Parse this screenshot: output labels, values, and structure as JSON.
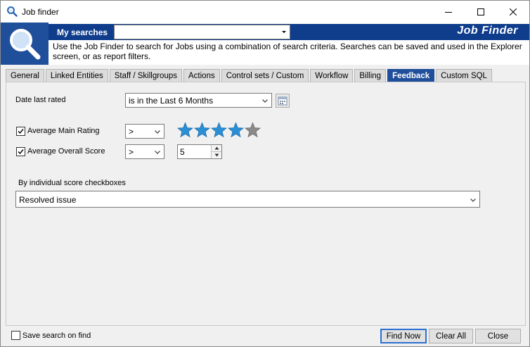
{
  "window": {
    "title": "Job finder",
    "icon": "search-icon"
  },
  "header": {
    "my_searches_label": "My searches",
    "my_searches_value": "",
    "brand": "Job Finder",
    "description": "Use the Job Finder to search for Jobs using a combination of search criteria.  Searches can be saved and used in the Explorer screen, or as report filters."
  },
  "tabs": [
    {
      "label": "General"
    },
    {
      "label": "Linked Entities"
    },
    {
      "label": "Staff / Skillgroups"
    },
    {
      "label": "Actions"
    },
    {
      "label": "Control sets / Custom"
    },
    {
      "label": "Workflow"
    },
    {
      "label": "Billing"
    },
    {
      "label": "Feedback",
      "active": true
    },
    {
      "label": "Custom SQL"
    }
  ],
  "feedback": {
    "date_last_rated_label": "Date last rated",
    "date_last_rated_value": "is in the Last 6 Months",
    "avg_main_rating": {
      "label": "Average Main Rating",
      "checked": true,
      "operator": ">",
      "rating": 4,
      "max_rating": 5
    },
    "avg_overall_score": {
      "label": "Average Overall Score",
      "checked": true,
      "operator": ">",
      "value": "5"
    },
    "individual_label": "By individual score checkboxes",
    "individual_value": "Resolved issue"
  },
  "footer": {
    "save_search_label": "Save search on find",
    "save_search_checked": false,
    "find_now": "Find Now",
    "clear_all": "Clear All",
    "close": "Close"
  },
  "colors": {
    "accent": "#1f4e9a",
    "banner": "#0f3d8c",
    "star_filled": "#2b8fd6",
    "star_empty": "#8a8a8a"
  }
}
